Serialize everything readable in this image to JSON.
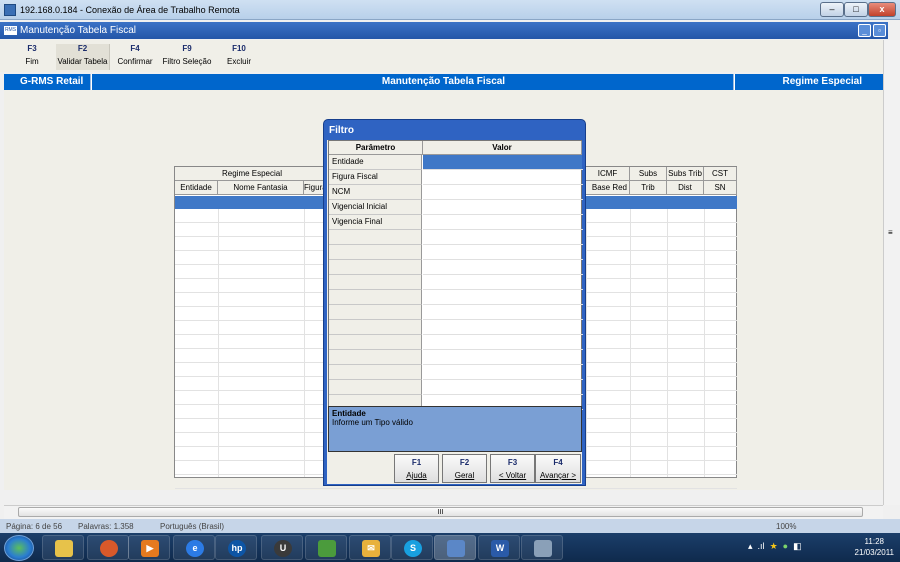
{
  "rdp": {
    "title": "192.168.0.184 - Conexão de Área de Trabalho Remota",
    "min": "–",
    "max": "□",
    "close": "x"
  },
  "app": {
    "title": "Manutenção Tabela Fiscal",
    "icon_text": "RMS"
  },
  "toolbar": [
    {
      "key": "F3",
      "label": "Fim"
    },
    {
      "key": "F2",
      "label": "Validar Tabela"
    },
    {
      "key": "F4",
      "label": "Confirmar"
    },
    {
      "key": "F9",
      "label": "Filtro Seleção"
    },
    {
      "key": "F10",
      "label": "Excluir"
    }
  ],
  "header": {
    "left": "G-RMS Retail",
    "center": "Manutenção Tabela Fiscal",
    "right": "Regime Especial"
  },
  "grid": {
    "group1": "Regime Especial",
    "cols": [
      "Entidade",
      "Nome Fantasia",
      "Figura",
      "ICMF",
      "Base Red",
      "Subs",
      "Trib",
      "Subs Trib",
      "Dist",
      "CST",
      "SN"
    ]
  },
  "filtro": {
    "title": "Filtro",
    "col_param": "Parâmetro",
    "col_valor": "Valor",
    "params": [
      "Entidade",
      "Figura Fiscal",
      "NCM",
      "Vigencial Inicial",
      "Vigencia Final"
    ],
    "desc_title": "Entidade",
    "desc_text": "Informe um Tipo válido",
    "buttons": [
      {
        "key": "F1",
        "label": "Ajuda"
      },
      {
        "key": "F2",
        "label": "Geral"
      },
      {
        "key": "F3",
        "label": "< Voltar"
      },
      {
        "key": "F4",
        "label": "Avançar >"
      }
    ]
  },
  "statusbar": {
    "page": "Página: 6 de 56",
    "words": "Palavras: 1.358",
    "lang": "Português (Brasil)",
    "zoom": "100%"
  },
  "clock": {
    "time": "11:28",
    "date": "21/03/2011"
  },
  "scroll": {
    "h_grip": "III",
    "v_grip": "≡"
  }
}
